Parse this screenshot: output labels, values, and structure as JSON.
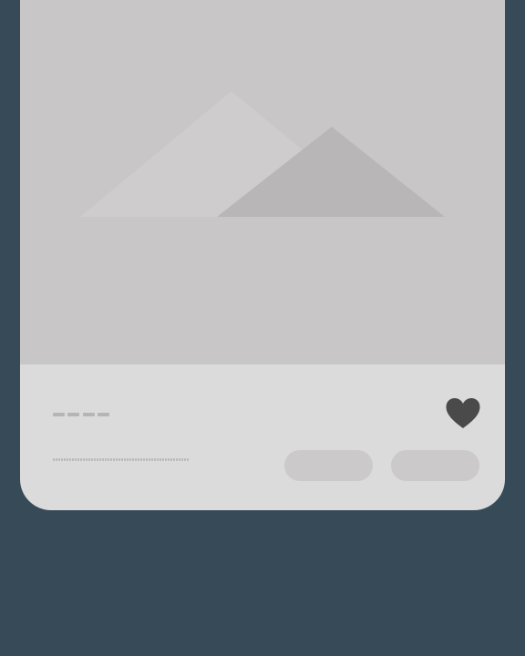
{
  "card": {
    "image": {
      "icon": "image-placeholder-mountains-icon"
    },
    "footer": {
      "favorite": {
        "icon": "heart-icon",
        "state": "filled"
      },
      "buttons": [
        {
          "label": ""
        },
        {
          "label": ""
        }
      ]
    }
  },
  "colors": {
    "background": "#374a58",
    "card": "#dbdbdb",
    "media": "#c8c6c7",
    "mountain_back": "#cecccd",
    "mountain_front": "#b8b6b7",
    "heart": "#4a4a4a",
    "button": "#cbc9ca",
    "skeleton_text": "#b5b5b5"
  }
}
